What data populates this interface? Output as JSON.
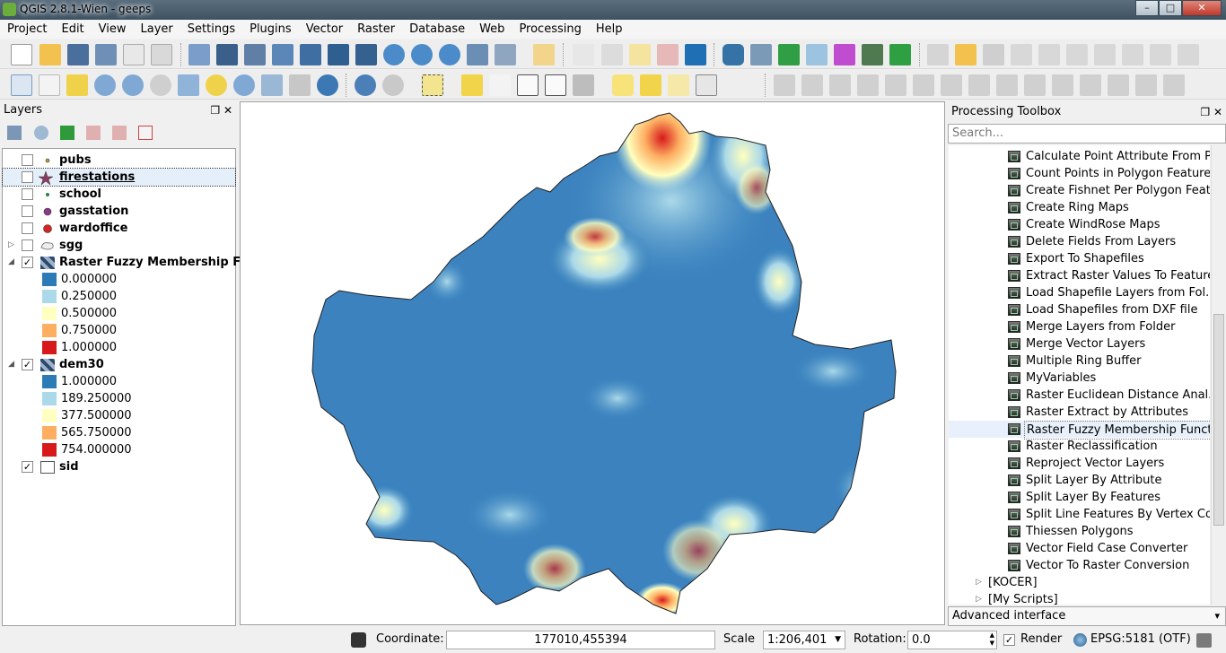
{
  "window": {
    "title": "QGIS 2.8.1-Wien - geeps",
    "min": "–",
    "max": "□",
    "close": "✕"
  },
  "menu": [
    "Project",
    "Edit",
    "View",
    "Layer",
    "Settings",
    "Plugins",
    "Vector",
    "Raster",
    "Database",
    "Web",
    "Processing",
    "Help"
  ],
  "layers_panel": {
    "title": "Layers",
    "float": "❐",
    "close": "✕",
    "layers": [
      {
        "name": "pubs",
        "checked": "",
        "symbol": "dot-small-olive"
      },
      {
        "name": "firestations",
        "checked": "",
        "symbol": "star"
      },
      {
        "name": "school",
        "checked": "",
        "symbol": "dot-small-green"
      },
      {
        "name": "gasstation",
        "checked": "",
        "symbol": "dot-purple"
      },
      {
        "name": "wardoffice",
        "checked": "",
        "symbol": "dot-red"
      },
      {
        "name": "sgg",
        "checked": "",
        "symbol": "polygon"
      },
      {
        "name": "Raster Fuzzy Membership Fu...",
        "checked": "✓",
        "symbol": "raster"
      },
      {
        "name": "dem30",
        "checked": "✓",
        "symbol": "raster"
      },
      {
        "name": "sid",
        "checked": "✓",
        "symbol": "polygon-empty"
      }
    ],
    "expanders": {
      "sgg": "▷",
      "fuzzy": "◢",
      "dem": "◢"
    },
    "fuzzy_legend": [
      "0.000000",
      "0.250000",
      "0.500000",
      "0.750000",
      "1.000000"
    ],
    "dem_legend": [
      "1.000000",
      "189.250000",
      "377.500000",
      "565.750000",
      "754.000000"
    ],
    "legend_colors": [
      "#2c7bb6",
      "#abd9e9",
      "#ffffbf",
      "#fdae61",
      "#d7191c"
    ]
  },
  "toolbox": {
    "title": "Processing Toolbox",
    "search_placeholder": "Search...",
    "items": [
      "Calculate Point Attribute From P...",
      "Count Points in Polygon Features",
      "Create Fishnet Per Polygon Feat...",
      "Create Ring Maps",
      "Create WindRose Maps",
      "Delete Fields From Layers",
      "Export To Shapefiles",
      "Extract Raster Values To Features",
      "Load Shapefile Layers from Fol...",
      "Load Shapefiles from DXF file",
      "Merge Layers from Folder",
      "Merge Vector Layers",
      "Multiple Ring Buffer",
      "MyVariables",
      "Raster Euclidean Distance Anal...",
      "Raster Extract by Attributes",
      "Raster Fuzzy Membership Funct...",
      "Raster Reclassification",
      "Reproject Vector Layers",
      "Split Layer By Attribute",
      "Split Layer By Features",
      "Split Line Features By Vertex Co...",
      "Thiessen Polygons",
      "Vector Field Case Converter",
      "Vector To Raster Conversion"
    ],
    "selected_index": 16,
    "groups": [
      "[KOCER]",
      "[My Scripts]"
    ],
    "group_arrow": "▷",
    "advanced": "Advanced interface",
    "advanced_arrow": "▾"
  },
  "status": {
    "coordinate_label": "Coordinate:",
    "coordinate": "177010,455394",
    "scale_label": "Scale",
    "scale": "1:206,401",
    "rotation_label": "Rotation:",
    "rotation": "0.0",
    "render_label": "Render",
    "render_checked": "✓",
    "crs": "EPSG:5181 (OTF)"
  },
  "colors": {
    "accent": "#3c79b4",
    "selection": "#cde3f7"
  }
}
